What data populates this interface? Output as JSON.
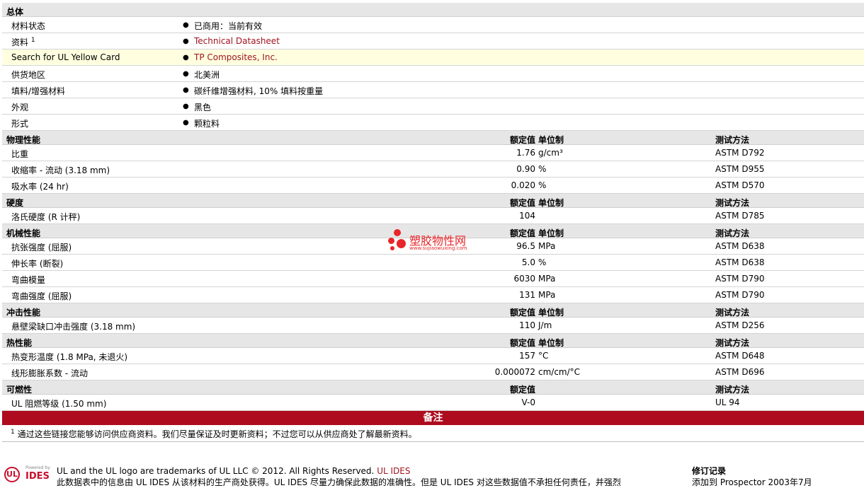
{
  "sections": [
    {
      "title": "总体",
      "kind": "general",
      "rows": [
        {
          "label": "材料状态",
          "value": "已商用：当前有效"
        },
        {
          "label": "资料",
          "sup": "1",
          "value": "Technical Datasheet",
          "link": true
        },
        {
          "label": "Search for UL Yellow Card",
          "value": "TP Composites, Inc.",
          "link": true,
          "highlight": true
        },
        {
          "label": "供货地区",
          "value": "北美洲"
        },
        {
          "label": "填料/增强材料",
          "value": "碳纤维增强材料, 10% 填料按重量"
        },
        {
          "label": "外观",
          "value": "黑色"
        },
        {
          "label": "形式",
          "value": "颗粒料"
        }
      ]
    },
    {
      "title": "物理性能",
      "kind": "prop",
      "h_value": "额定值",
      "h_unit": "单位制",
      "h_test": "测试方法",
      "rows": [
        {
          "label": "比重",
          "value": "1.76",
          "unit": "g/cm³",
          "test": "ASTM D792"
        },
        {
          "label": "收缩率 - 流动 (3.18 mm)",
          "value": "0.90",
          "unit": "%",
          "test": "ASTM D955"
        },
        {
          "label": "吸水率 (24 hr)",
          "value": "0.020",
          "unit": "%",
          "test": "ASTM D570"
        }
      ]
    },
    {
      "title": "硬度",
      "kind": "prop",
      "h_value": "额定值",
      "h_unit": "单位制",
      "h_test": "测试方法",
      "rows": [
        {
          "label": "洛氏硬度 (R 计秤)",
          "value": "104",
          "unit": "",
          "test": "ASTM D785"
        }
      ]
    },
    {
      "title": "机械性能",
      "kind": "prop",
      "h_value": "额定值",
      "h_unit": "单位制",
      "h_test": "测试方法",
      "rows": [
        {
          "label": "抗张强度 (屈服)",
          "value": "96.5",
          "unit": "MPa",
          "test": "ASTM D638"
        },
        {
          "label": "伸长率 (断裂)",
          "value": "5.0",
          "unit": "%",
          "test": "ASTM D638"
        },
        {
          "label": "弯曲模量",
          "value": "6030",
          "unit": "MPa",
          "test": "ASTM D790"
        },
        {
          "label": "弯曲强度 (屈服)",
          "value": "131",
          "unit": "MPa",
          "test": "ASTM D790"
        }
      ]
    },
    {
      "title": "冲击性能",
      "kind": "prop",
      "h_value": "额定值",
      "h_unit": "单位制",
      "h_test": "测试方法",
      "rows": [
        {
          "label": "悬壁梁缺口冲击强度 (3.18 mm)",
          "value": "110",
          "unit": "J/m",
          "test": "ASTM D256"
        }
      ]
    },
    {
      "title": "热性能",
      "kind": "prop",
      "h_value": "额定值",
      "h_unit": "单位制",
      "h_test": "测试方法",
      "rows": [
        {
          "label": "热变形温度 (1.8 MPa, 未退火)",
          "value": "157",
          "unit": "°C",
          "test": "ASTM D648"
        },
        {
          "label": "线形膨胀系数 - 流动",
          "value": "0.000072",
          "unit": "cm/cm/°C",
          "test": "ASTM D696"
        }
      ]
    },
    {
      "title": "可燃性",
      "kind": "prop",
      "h_value": "额定值",
      "h_unit": "",
      "h_test": "测试方法",
      "rows": [
        {
          "label": "UL 阻燃等级 (1.50 mm)",
          "value": "V-0",
          "unit": "",
          "test": "UL 94"
        }
      ]
    }
  ],
  "notes": {
    "title": "备注",
    "items": [
      {
        "sup": "1",
        "text": "通过这些链接您能够访问供应商资料。我们尽量保证及时更新资料；不过您可以从供应商处了解最新资料。"
      }
    ]
  },
  "footer": {
    "logo_ul": "UL",
    "logo_powered": "Powered by",
    "logo_ides": "IDES",
    "trademark": "UL and the UL logo are trademarks of UL LLC © 2012. All Rights Reserved.",
    "trademark_link": "UL IDES",
    "disclaimer": "此数据表中的信息由 UL IDES 从该材料的生产商处获得。UL IDES 尽量力确保此数据的准确性。但是 UL IDES 对这些数据值不承担任何责任，并强烈",
    "revision_title": "修订记录",
    "revision_text": "添加到 Prospector    2003年7月"
  },
  "watermark": {
    "name": "塑胶物性网",
    "url": "www.sujiaowuxing.com"
  },
  "colors": {
    "section_bg": "#e6e6e6",
    "highlight_bg": "#ffffe0",
    "link": "#a0141e",
    "notes_bar": "#ae0b1e"
  }
}
